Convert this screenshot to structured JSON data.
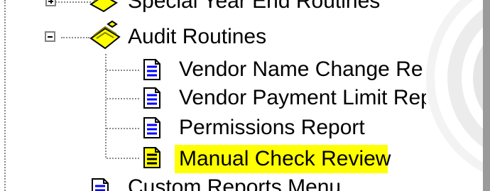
{
  "tree": {
    "items": [
      {
        "label": "Special Year End Routines",
        "type": "folder",
        "expander": "plus",
        "clipped": true
      },
      {
        "label": "Audit Routines",
        "type": "folder",
        "expander": "minus"
      },
      {
        "label": "Vendor Name Change Re",
        "type": "report"
      },
      {
        "label": "Vendor Payment Limit Rep",
        "type": "report"
      },
      {
        "label": "Permissions Report",
        "type": "report"
      },
      {
        "label": "Manual Check Review",
        "type": "report",
        "selected": true
      },
      {
        "label": "Custom Reports Menu",
        "type": "report",
        "clipped": true
      }
    ]
  },
  "colors": {
    "selection": "#ffff00",
    "report_icon_blue": "#0000ff",
    "folder_yellow": "#ffff00",
    "tree_lines": "#8a8a8a"
  },
  "icons": {
    "folder": "folder-icon",
    "report": "document-icon",
    "expand": "expand-plus-icon",
    "collapse": "collapse-minus-icon"
  }
}
